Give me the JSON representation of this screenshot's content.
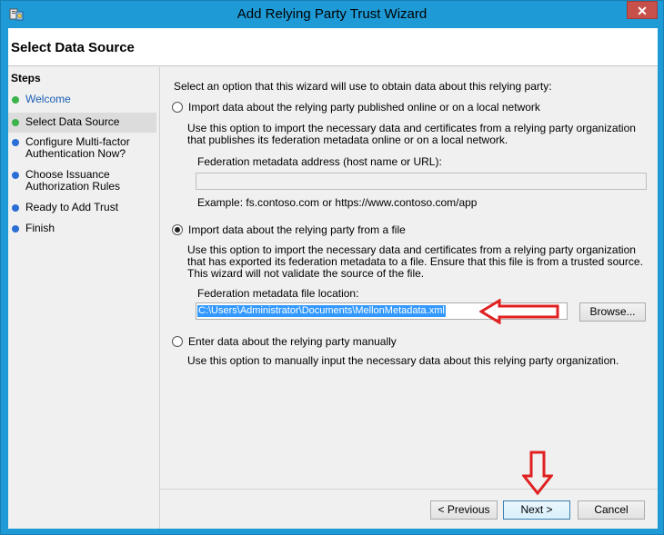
{
  "window": {
    "title": "Add Relying Party Trust Wizard",
    "close_label": "✕"
  },
  "header": {
    "title": "Select Data Source"
  },
  "steps": {
    "title": "Steps",
    "items": [
      {
        "label": "Welcome",
        "status": "done",
        "color": "#3cb34a"
      },
      {
        "label": "Select Data Source",
        "status": "current",
        "color": "#3cb34a"
      },
      {
        "label": "Configure Multi-factor\nAuthentication Now?",
        "status": "pending",
        "color": "#2b6fd6"
      },
      {
        "label": "Choose Issuance\nAuthorization Rules",
        "status": "pending",
        "color": "#2b6fd6"
      },
      {
        "label": "Ready to Add Trust",
        "status": "pending",
        "color": "#2b6fd6"
      },
      {
        "label": "Finish",
        "status": "pending",
        "color": "#2b6fd6"
      }
    ]
  },
  "content": {
    "intro": "Select an option that this wizard will use to obtain data about this relying party:",
    "option1": {
      "label": "Import data about the relying party published online or on a local network",
      "description": "Use this option to import the necessary data and certificates from a relying party organization that publishes its federation metadata online or on a local network.",
      "field_label": "Federation metadata address (host name or URL):",
      "field_value": "",
      "example": "Example: fs.contoso.com or https://www.contoso.com/app",
      "selected": false
    },
    "option2": {
      "label": "Import data about the relying party from a file",
      "description": "Use this option to import the necessary data and certificates from a relying party organization that has exported its federation metadata to a file. Ensure that this file is from a trusted source.  This wizard will not validate the source of the file.",
      "field_label": "Federation metadata file location:",
      "field_value": "C:\\Users\\Administrator\\Documents\\MellonMetadata.xml",
      "browse_label": "Browse...",
      "selected": true
    },
    "option3": {
      "label": "Enter data about the relying party manually",
      "description": "Use this option to manually input the necessary data about this relying party organization.",
      "selected": false
    }
  },
  "footer": {
    "previous_label": "< Previous",
    "next_label": "Next >",
    "cancel_label": "Cancel"
  },
  "colors": {
    "titlebar": "#1e9bd7",
    "close": "#c7504b",
    "annotation_arrow": "#e02020",
    "selection": "#3399ff"
  }
}
